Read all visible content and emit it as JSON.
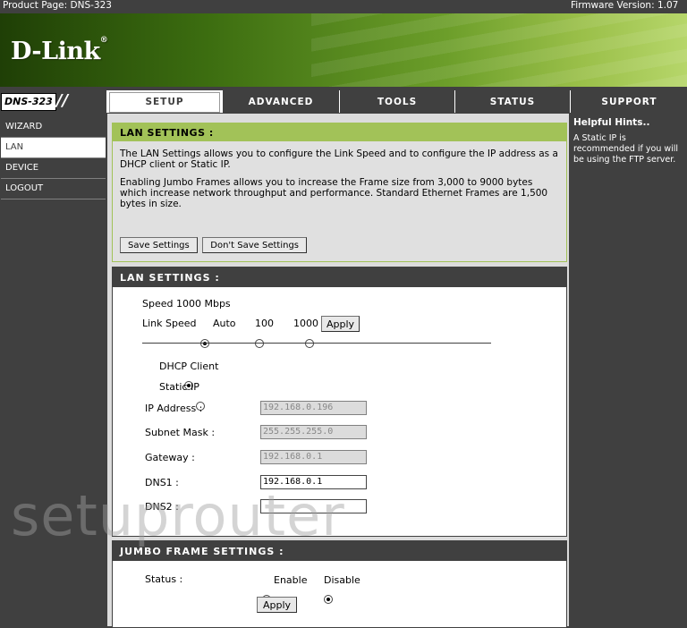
{
  "header": {
    "product_page": "Product Page: DNS-323",
    "firmware_version": "Firmware Version: 1.07",
    "brand": "D-Link",
    "brand_mark": "®",
    "model": "DNS-323"
  },
  "nav": {
    "tabs": [
      "SETUP",
      "ADVANCED",
      "TOOLS",
      "STATUS",
      "SUPPORT"
    ],
    "active_tab": "SETUP"
  },
  "sidebar": {
    "items": [
      "WIZARD",
      "LAN",
      "DEVICE",
      "LOGOUT"
    ],
    "active": "LAN"
  },
  "intro": {
    "title": "LAN SETTINGS :",
    "para1": "The LAN Settings allows you to configure the Link Speed and to configure the IP address as a DHCP client or Static IP.",
    "para2": "Enabling Jumbo Frames allows you to increase the Frame size from 3,000 to 9000 bytes which increase network throughput and performance. Standard Ethernet Frames are 1,500 bytes in size.",
    "save_label": "Save Settings",
    "dont_save_label": "Don't Save Settings"
  },
  "lan": {
    "title": "LAN SETTINGS :",
    "speed_text": "Speed 1000 Mbps",
    "link_speed_label": "Link Speed",
    "link_speed_options": [
      "Auto",
      "100",
      "1000"
    ],
    "link_speed_selected": "Auto",
    "apply_label": "Apply",
    "mode_options": [
      "DHCP Client",
      "Static IP"
    ],
    "mode_selected": "DHCP Client",
    "ip_label": "IP Address :",
    "ip_value": "192.168.0.196",
    "mask_label": "Subnet Mask :",
    "mask_value": "255.255.255.0",
    "gateway_label": "Gateway :",
    "gateway_value": "192.168.0.1",
    "dns1_label": "DNS1 :",
    "dns1_value": "192.168.0.1",
    "dns2_label": "DNS2 :",
    "dns2_value": ""
  },
  "jumbo": {
    "title": "JUMBO FRAME SETTINGS :",
    "status_label": "Status :",
    "options": [
      "Enable",
      "Disable"
    ],
    "selected": "Disable",
    "apply_label": "Apply"
  },
  "hints": {
    "title": "Helpful Hints..",
    "text": "A Static IP is recommended if you will be using the FTP server."
  },
  "watermark": "setuprouter",
  "colors": {
    "dark": "#404040",
    "accent_green": "#a2c258",
    "content_bg": "#dcdcdc"
  }
}
